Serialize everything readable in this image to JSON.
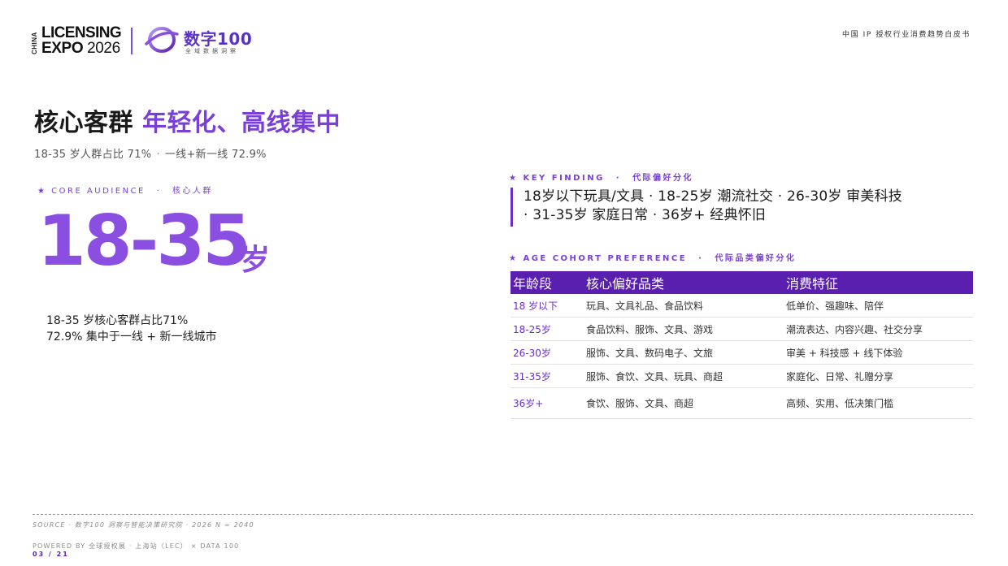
{
  "header": {
    "logo_china": "CHINA",
    "logo_line1": "LICENSING",
    "logo_line2_a": "EXPO",
    "logo_line2_b": "2026",
    "logo_cn": "数字100",
    "logo_cn_sub": "全域数据洞察",
    "report_title": "中国 IP 授权行业消费趋势白皮书"
  },
  "headline": {
    "prefix": "核心客群",
    "accent": "年轻化、高线集中"
  },
  "subline": {
    "part1": "18-35 岁人群占比 71%",
    "dot": "·",
    "part2": "一线+新一线 72.9%"
  },
  "core": {
    "star": "★",
    "label_en": "CORE AUDIENCE",
    "sep": "·",
    "label_cn": "核心人群",
    "big_number": "18-35",
    "big_suffix": "岁",
    "desc1": "18-35 岁核心客群占比71%",
    "desc2": "72.9% 集中于一线 + 新一线城市"
  },
  "key_finding": {
    "star": "★",
    "label_en": "KEY FINDING",
    "sep": "·",
    "label_cn": "代际偏好分化",
    "line1": "18岁以下玩具/文具 · 18-25岁 潮流社交 · 26-30岁 审美科技",
    "line2": "· 31-35岁 家庭日常 · 36岁+ 经典怀旧"
  },
  "cohort": {
    "star": "★",
    "label_en": "AGE COHORT PREFERENCE",
    "sep": "·",
    "label_cn": "代际品类偏好分化",
    "columns": [
      "年龄段",
      "核心偏好品类",
      "消费特征"
    ],
    "rows": [
      [
        "18 岁以下",
        "玩具、文具礼品、食品饮料",
        "低单价、强趣味、陪伴"
      ],
      [
        "18-25岁",
        "食品饮料、服饰、文具、游戏",
        "潮流表达、内容兴趣、社交分享"
      ],
      [
        "26-30岁",
        "服饰、文具、数码电子、文旅",
        "审美 + 科技感 + 线下体验"
      ],
      [
        "31-35岁",
        "服饰、食饮、文具、玩具、商超",
        "家庭化、日常、礼赠分享"
      ],
      [
        "36岁+",
        "食饮、服饰、文具、商超",
        "高频、实用、低决策门槛"
      ]
    ]
  },
  "footer": {
    "source": "SOURCE · 数字100 洞察与智能决策研究院 · 2026 N = 2040",
    "powered": "POWERED BY 全球授权展 · 上海站（LEC） × DATA 100",
    "page": "03 / 21"
  },
  "colors": {
    "accent": "#7a3fd6",
    "big_number": "#8a4fe0",
    "table_header": "#5a1fae"
  }
}
